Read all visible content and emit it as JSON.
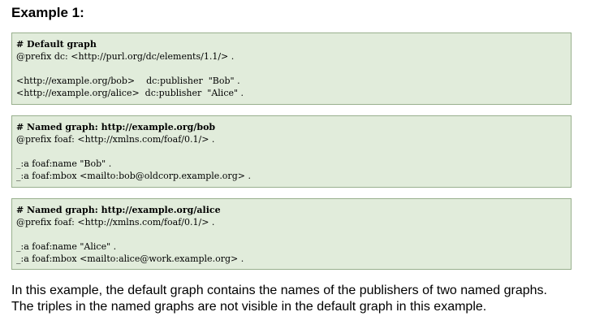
{
  "heading": "Example 1:",
  "blocks": [
    {
      "lines": [
        "# Default graph",
        "@prefix dc: <http://purl.org/dc/elements/1.1/> .",
        "",
        "<http://example.org/bob>    dc:publisher  \"Bob\" .",
        "<http://example.org/alice>  dc:publisher  \"Alice\" ."
      ]
    },
    {
      "lines": [
        "# Named graph: http://example.org/bob",
        "@prefix foaf: <http://xmlns.com/foaf/0.1/> .",
        "",
        "_:a foaf:name \"Bob\" .",
        "_:a foaf:mbox <mailto:bob@oldcorp.example.org> ."
      ]
    },
    {
      "lines": [
        "# Named graph: http://example.org/alice",
        "@prefix foaf: <http://xmlns.com/foaf/0.1/> .",
        "",
        "_:a foaf:name \"Alice\" .",
        "_:a foaf:mbox <mailto:alice@work.example.org> ."
      ]
    }
  ],
  "description": {
    "line1": "In this example, the default graph contains the names of the publishers of two named graphs.",
    "line2": "The triples in the named graphs are not visible in the default graph in this example."
  },
  "colors": {
    "code_background": "#e1ecdb",
    "code_border": "#99b08e"
  }
}
